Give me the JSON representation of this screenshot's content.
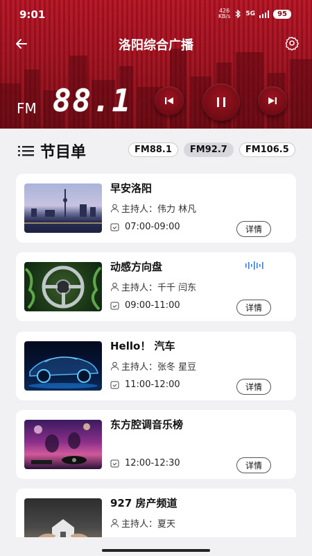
{
  "status": {
    "time": "9:01",
    "net_speed_value": "426",
    "net_speed_unit": "KB/s",
    "network": "5G",
    "battery": "95"
  },
  "header": {
    "title": "洛阳综合广播",
    "fm_label": "FM",
    "frequency": "88.1"
  },
  "icons": {
    "back": "arrow-left-icon",
    "settings": "gear-icon",
    "prev": "skip-previous-icon",
    "pause": "pause-icon",
    "next": "skip-next-icon",
    "list": "list-icon",
    "person": "person-icon",
    "clock": "calendar-clock-icon",
    "playing": "sound-wave-icon"
  },
  "schedule": {
    "title": "节目单",
    "channels": [
      "FM88.1",
      "FM92.7",
      "FM106.5"
    ],
    "active_channel": "FM92.7"
  },
  "programs": [
    {
      "name": "早安洛阳",
      "host": "主持人：伟力 林凡",
      "time": "07:00-09:00",
      "detail": "详情",
      "playing": false
    },
    {
      "name": "动感方向盘",
      "host": "主持人：千千 闫东",
      "time": "09:00-11:00",
      "detail": "详情",
      "playing": true
    },
    {
      "name": "Hello！ 汽车",
      "host": "主持人：张冬 星豆",
      "time": "11:00-12:00",
      "detail": "详情",
      "playing": false
    },
    {
      "name": "东方腔调音乐榜",
      "host": "",
      "time": "12:00-12:30",
      "detail": "详情",
      "playing": false
    },
    {
      "name": "927 房产频道",
      "host": "主持人：夏天",
      "time": "",
      "detail": "",
      "playing": false
    }
  ],
  "colors": {
    "accent": "#a10f1d",
    "background": "#f1f1f3"
  }
}
